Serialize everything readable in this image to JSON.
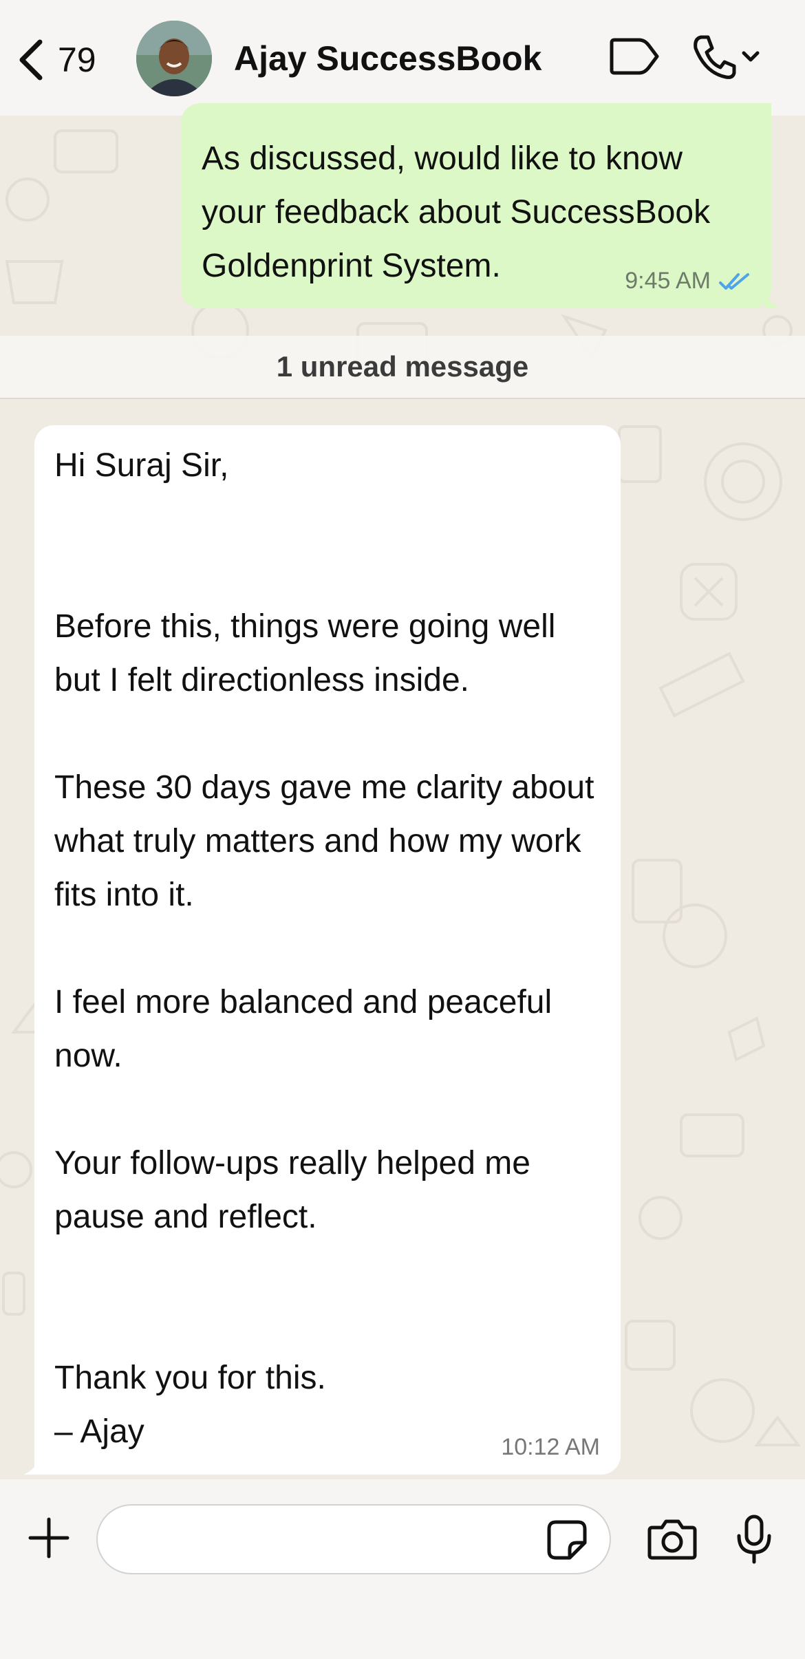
{
  "header": {
    "back_count": "79",
    "contact_name": "Ajay SuccessBook",
    "icons": [
      "chevron-left-icon",
      "video-icon",
      "phone-icon",
      "chevron-down-icon"
    ]
  },
  "messages": {
    "outgoing": {
      "text": "As discussed, would like to know your feedback about SuccessBook Goldenprint System.",
      "time": "9:45 AM",
      "status": "read"
    },
    "unread_divider": "1 unread message",
    "incoming": {
      "paragraphs": [
        "Hi Suraj Sir,",
        "",
        "",
        "Before this, things were going well but I felt directionless inside.",
        "",
        "These 30 days gave me clarity about what truly matters and how my work fits into it.",
        "",
        "I feel more balanced and peaceful now.",
        "",
        "Your follow-ups really helped me pause and reflect.",
        "",
        "",
        "Thank you for this.",
        "– Ajay"
      ],
      "time": "10:12 AM"
    }
  },
  "input_bar": {
    "value": "",
    "placeholder": "",
    "icons": [
      "plus-icon",
      "sticker-icon",
      "camera-icon",
      "microphone-icon"
    ]
  },
  "colors": {
    "outgoing_bubble": "#dcf8c6",
    "incoming_bubble": "#ffffff",
    "read_ticks": "#4fa3e8",
    "wallpaper": "#efeae2"
  }
}
